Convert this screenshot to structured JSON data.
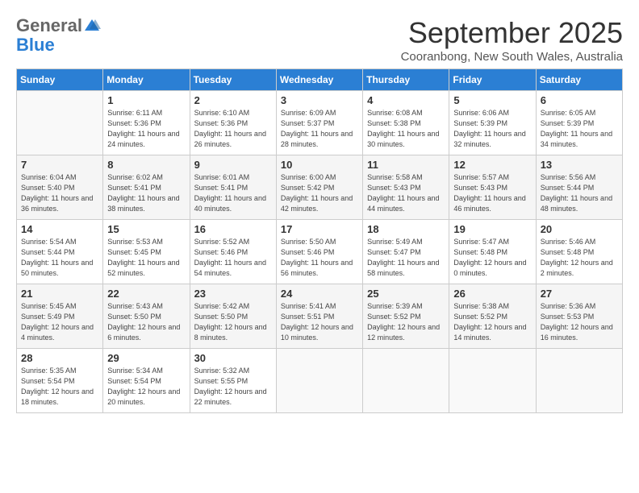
{
  "logo": {
    "general": "General",
    "blue": "Blue"
  },
  "title": "September 2025",
  "subtitle": "Cooranbong, New South Wales, Australia",
  "days_of_week": [
    "Sunday",
    "Monday",
    "Tuesday",
    "Wednesday",
    "Thursday",
    "Friday",
    "Saturday"
  ],
  "weeks": [
    [
      {
        "day": "",
        "sunrise": "",
        "sunset": "",
        "daylight": ""
      },
      {
        "day": "1",
        "sunrise": "Sunrise: 6:11 AM",
        "sunset": "Sunset: 5:36 PM",
        "daylight": "Daylight: 11 hours and 24 minutes."
      },
      {
        "day": "2",
        "sunrise": "Sunrise: 6:10 AM",
        "sunset": "Sunset: 5:36 PM",
        "daylight": "Daylight: 11 hours and 26 minutes."
      },
      {
        "day": "3",
        "sunrise": "Sunrise: 6:09 AM",
        "sunset": "Sunset: 5:37 PM",
        "daylight": "Daylight: 11 hours and 28 minutes."
      },
      {
        "day": "4",
        "sunrise": "Sunrise: 6:08 AM",
        "sunset": "Sunset: 5:38 PM",
        "daylight": "Daylight: 11 hours and 30 minutes."
      },
      {
        "day": "5",
        "sunrise": "Sunrise: 6:06 AM",
        "sunset": "Sunset: 5:39 PM",
        "daylight": "Daylight: 11 hours and 32 minutes."
      },
      {
        "day": "6",
        "sunrise": "Sunrise: 6:05 AM",
        "sunset": "Sunset: 5:39 PM",
        "daylight": "Daylight: 11 hours and 34 minutes."
      }
    ],
    [
      {
        "day": "7",
        "sunrise": "Sunrise: 6:04 AM",
        "sunset": "Sunset: 5:40 PM",
        "daylight": "Daylight: 11 hours and 36 minutes."
      },
      {
        "day": "8",
        "sunrise": "Sunrise: 6:02 AM",
        "sunset": "Sunset: 5:41 PM",
        "daylight": "Daylight: 11 hours and 38 minutes."
      },
      {
        "day": "9",
        "sunrise": "Sunrise: 6:01 AM",
        "sunset": "Sunset: 5:41 PM",
        "daylight": "Daylight: 11 hours and 40 minutes."
      },
      {
        "day": "10",
        "sunrise": "Sunrise: 6:00 AM",
        "sunset": "Sunset: 5:42 PM",
        "daylight": "Daylight: 11 hours and 42 minutes."
      },
      {
        "day": "11",
        "sunrise": "Sunrise: 5:58 AM",
        "sunset": "Sunset: 5:43 PM",
        "daylight": "Daylight: 11 hours and 44 minutes."
      },
      {
        "day": "12",
        "sunrise": "Sunrise: 5:57 AM",
        "sunset": "Sunset: 5:43 PM",
        "daylight": "Daylight: 11 hours and 46 minutes."
      },
      {
        "day": "13",
        "sunrise": "Sunrise: 5:56 AM",
        "sunset": "Sunset: 5:44 PM",
        "daylight": "Daylight: 11 hours and 48 minutes."
      }
    ],
    [
      {
        "day": "14",
        "sunrise": "Sunrise: 5:54 AM",
        "sunset": "Sunset: 5:44 PM",
        "daylight": "Daylight: 11 hours and 50 minutes."
      },
      {
        "day": "15",
        "sunrise": "Sunrise: 5:53 AM",
        "sunset": "Sunset: 5:45 PM",
        "daylight": "Daylight: 11 hours and 52 minutes."
      },
      {
        "day": "16",
        "sunrise": "Sunrise: 5:52 AM",
        "sunset": "Sunset: 5:46 PM",
        "daylight": "Daylight: 11 hours and 54 minutes."
      },
      {
        "day": "17",
        "sunrise": "Sunrise: 5:50 AM",
        "sunset": "Sunset: 5:46 PM",
        "daylight": "Daylight: 11 hours and 56 minutes."
      },
      {
        "day": "18",
        "sunrise": "Sunrise: 5:49 AM",
        "sunset": "Sunset: 5:47 PM",
        "daylight": "Daylight: 11 hours and 58 minutes."
      },
      {
        "day": "19",
        "sunrise": "Sunrise: 5:47 AM",
        "sunset": "Sunset: 5:48 PM",
        "daylight": "Daylight: 12 hours and 0 minutes."
      },
      {
        "day": "20",
        "sunrise": "Sunrise: 5:46 AM",
        "sunset": "Sunset: 5:48 PM",
        "daylight": "Daylight: 12 hours and 2 minutes."
      }
    ],
    [
      {
        "day": "21",
        "sunrise": "Sunrise: 5:45 AM",
        "sunset": "Sunset: 5:49 PM",
        "daylight": "Daylight: 12 hours and 4 minutes."
      },
      {
        "day": "22",
        "sunrise": "Sunrise: 5:43 AM",
        "sunset": "Sunset: 5:50 PM",
        "daylight": "Daylight: 12 hours and 6 minutes."
      },
      {
        "day": "23",
        "sunrise": "Sunrise: 5:42 AM",
        "sunset": "Sunset: 5:50 PM",
        "daylight": "Daylight: 12 hours and 8 minutes."
      },
      {
        "day": "24",
        "sunrise": "Sunrise: 5:41 AM",
        "sunset": "Sunset: 5:51 PM",
        "daylight": "Daylight: 12 hours and 10 minutes."
      },
      {
        "day": "25",
        "sunrise": "Sunrise: 5:39 AM",
        "sunset": "Sunset: 5:52 PM",
        "daylight": "Daylight: 12 hours and 12 minutes."
      },
      {
        "day": "26",
        "sunrise": "Sunrise: 5:38 AM",
        "sunset": "Sunset: 5:52 PM",
        "daylight": "Daylight: 12 hours and 14 minutes."
      },
      {
        "day": "27",
        "sunrise": "Sunrise: 5:36 AM",
        "sunset": "Sunset: 5:53 PM",
        "daylight": "Daylight: 12 hours and 16 minutes."
      }
    ],
    [
      {
        "day": "28",
        "sunrise": "Sunrise: 5:35 AM",
        "sunset": "Sunset: 5:54 PM",
        "daylight": "Daylight: 12 hours and 18 minutes."
      },
      {
        "day": "29",
        "sunrise": "Sunrise: 5:34 AM",
        "sunset": "Sunset: 5:54 PM",
        "daylight": "Daylight: 12 hours and 20 minutes."
      },
      {
        "day": "30",
        "sunrise": "Sunrise: 5:32 AM",
        "sunset": "Sunset: 5:55 PM",
        "daylight": "Daylight: 12 hours and 22 minutes."
      },
      {
        "day": "",
        "sunrise": "",
        "sunset": "",
        "daylight": ""
      },
      {
        "day": "",
        "sunrise": "",
        "sunset": "",
        "daylight": ""
      },
      {
        "day": "",
        "sunrise": "",
        "sunset": "",
        "daylight": ""
      },
      {
        "day": "",
        "sunrise": "",
        "sunset": "",
        "daylight": ""
      }
    ]
  ]
}
